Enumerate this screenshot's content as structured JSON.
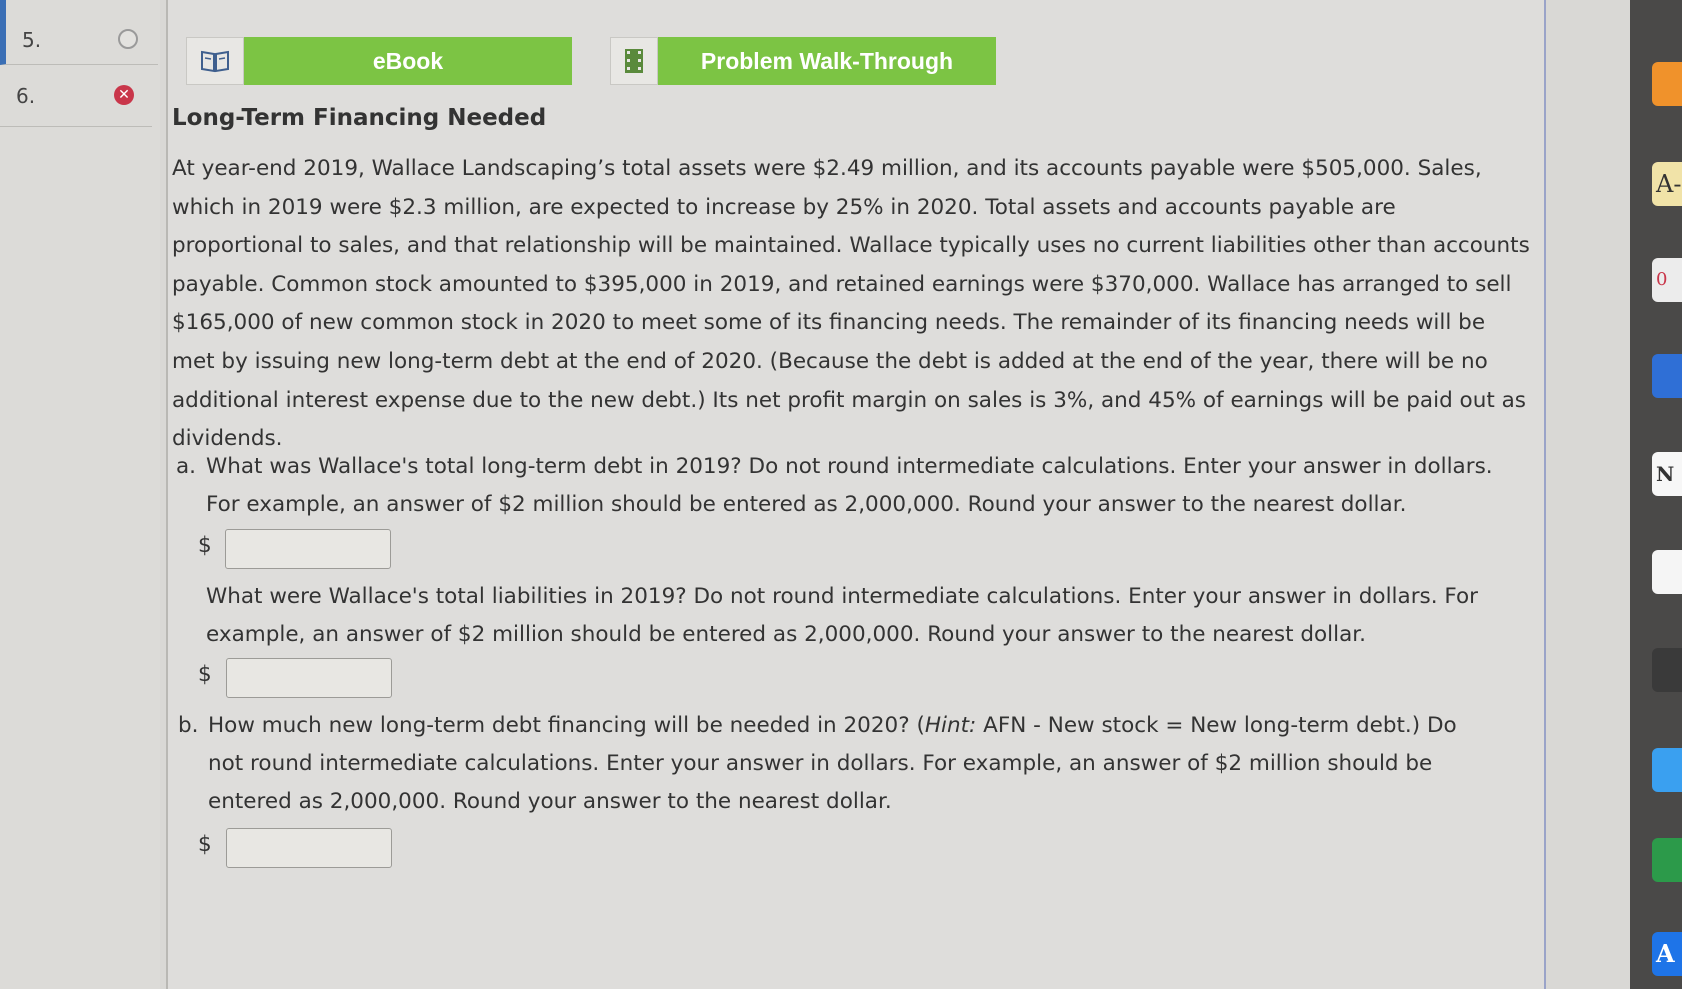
{
  "question_nav": {
    "items": [
      {
        "number": "5.",
        "status": "unanswered"
      },
      {
        "number": "6.",
        "status": "incorrect"
      }
    ]
  },
  "toolbar": {
    "ebook_label": "eBook",
    "walkthrough_label": "Problem Walk-Through"
  },
  "problem": {
    "title": "Long-Term Financing Needed",
    "intro": "At year-end 2019, Wallace Landscaping’s total assets were $2.49 million, and its accounts payable were $505,000. Sales, which in 2019 were $2.3 million, are expected to increase by 25% in 2020. Total assets and accounts payable are proportional to sales, and that relationship will be maintained. Wallace typically uses no current liabilities other than accounts payable. Common stock amounted to $395,000 in 2019, and retained earnings were $370,000. Wallace has arranged to sell $165,000 of new common stock in 2020 to meet some of its financing needs. The remainder of its financing needs will be met by issuing new long-term debt at the end of 2020. (Because the debt is added at the end of the year, there will be no additional interest expense due to the new debt.) Its net profit margin on sales is 3%, and 45% of earnings will be paid out as dividends.",
    "part_a": {
      "label": "a.",
      "q1_line1": "What was Wallace's total long-term debt in 2019? Do not round intermediate calculations. Enter your answer in dollars.",
      "q1_line2": "For example, an answer of $2 million should be entered as 2,000,000. Round your answer to the nearest dollar.",
      "q2_line1": "What were Wallace's total liabilities in 2019? Do not round intermediate calculations. Enter your answer in dollars. For",
      "q2_line2": "example, an answer of $2 million should be entered as 2,000,000. Round your answer to the nearest dollar."
    },
    "part_b": {
      "label": "b.",
      "line1_pre": "How much new long-term debt financing will be needed in 2020? (",
      "hint_word": "Hint:",
      "line1_post": " AFN - New stock = New long-term debt.) Do",
      "line2": "not round intermediate calculations. Enter your answer in dollars. For example, an answer of $2 million should be",
      "line3": "entered as 2,000,000. Round your answer to the nearest dollar."
    },
    "currency_symbol": "$",
    "answers": {
      "a_long_term_debt": "",
      "a_total_liabilities": "",
      "b_new_debt": ""
    }
  },
  "dock": {
    "items": [
      {
        "icon": "orange-app-icon",
        "text": "",
        "color": "#f0922b"
      },
      {
        "icon": "text-style-icon",
        "text": "A-",
        "color": "#f1e3a8"
      },
      {
        "icon": "notes-icon",
        "text": "0",
        "color": "#ececec"
      },
      {
        "icon": "blue-app-icon",
        "text": "",
        "color": "#2f6fd6"
      },
      {
        "icon": "notion-icon",
        "text": "N",
        "color": "#f7f7f7"
      },
      {
        "icon": "calendar-icon",
        "text": "",
        "color": "#f5f5f5"
      },
      {
        "icon": "podcast-icon",
        "text": "",
        "color": "#3a3a3a"
      },
      {
        "icon": "cloud-icon",
        "text": "",
        "color": "#3aa0f0"
      },
      {
        "icon": "drive-icon",
        "text": "",
        "color": "#2c9a4a"
      },
      {
        "icon": "app-store-icon",
        "text": "A",
        "color": "#1e74e8"
      }
    ]
  }
}
